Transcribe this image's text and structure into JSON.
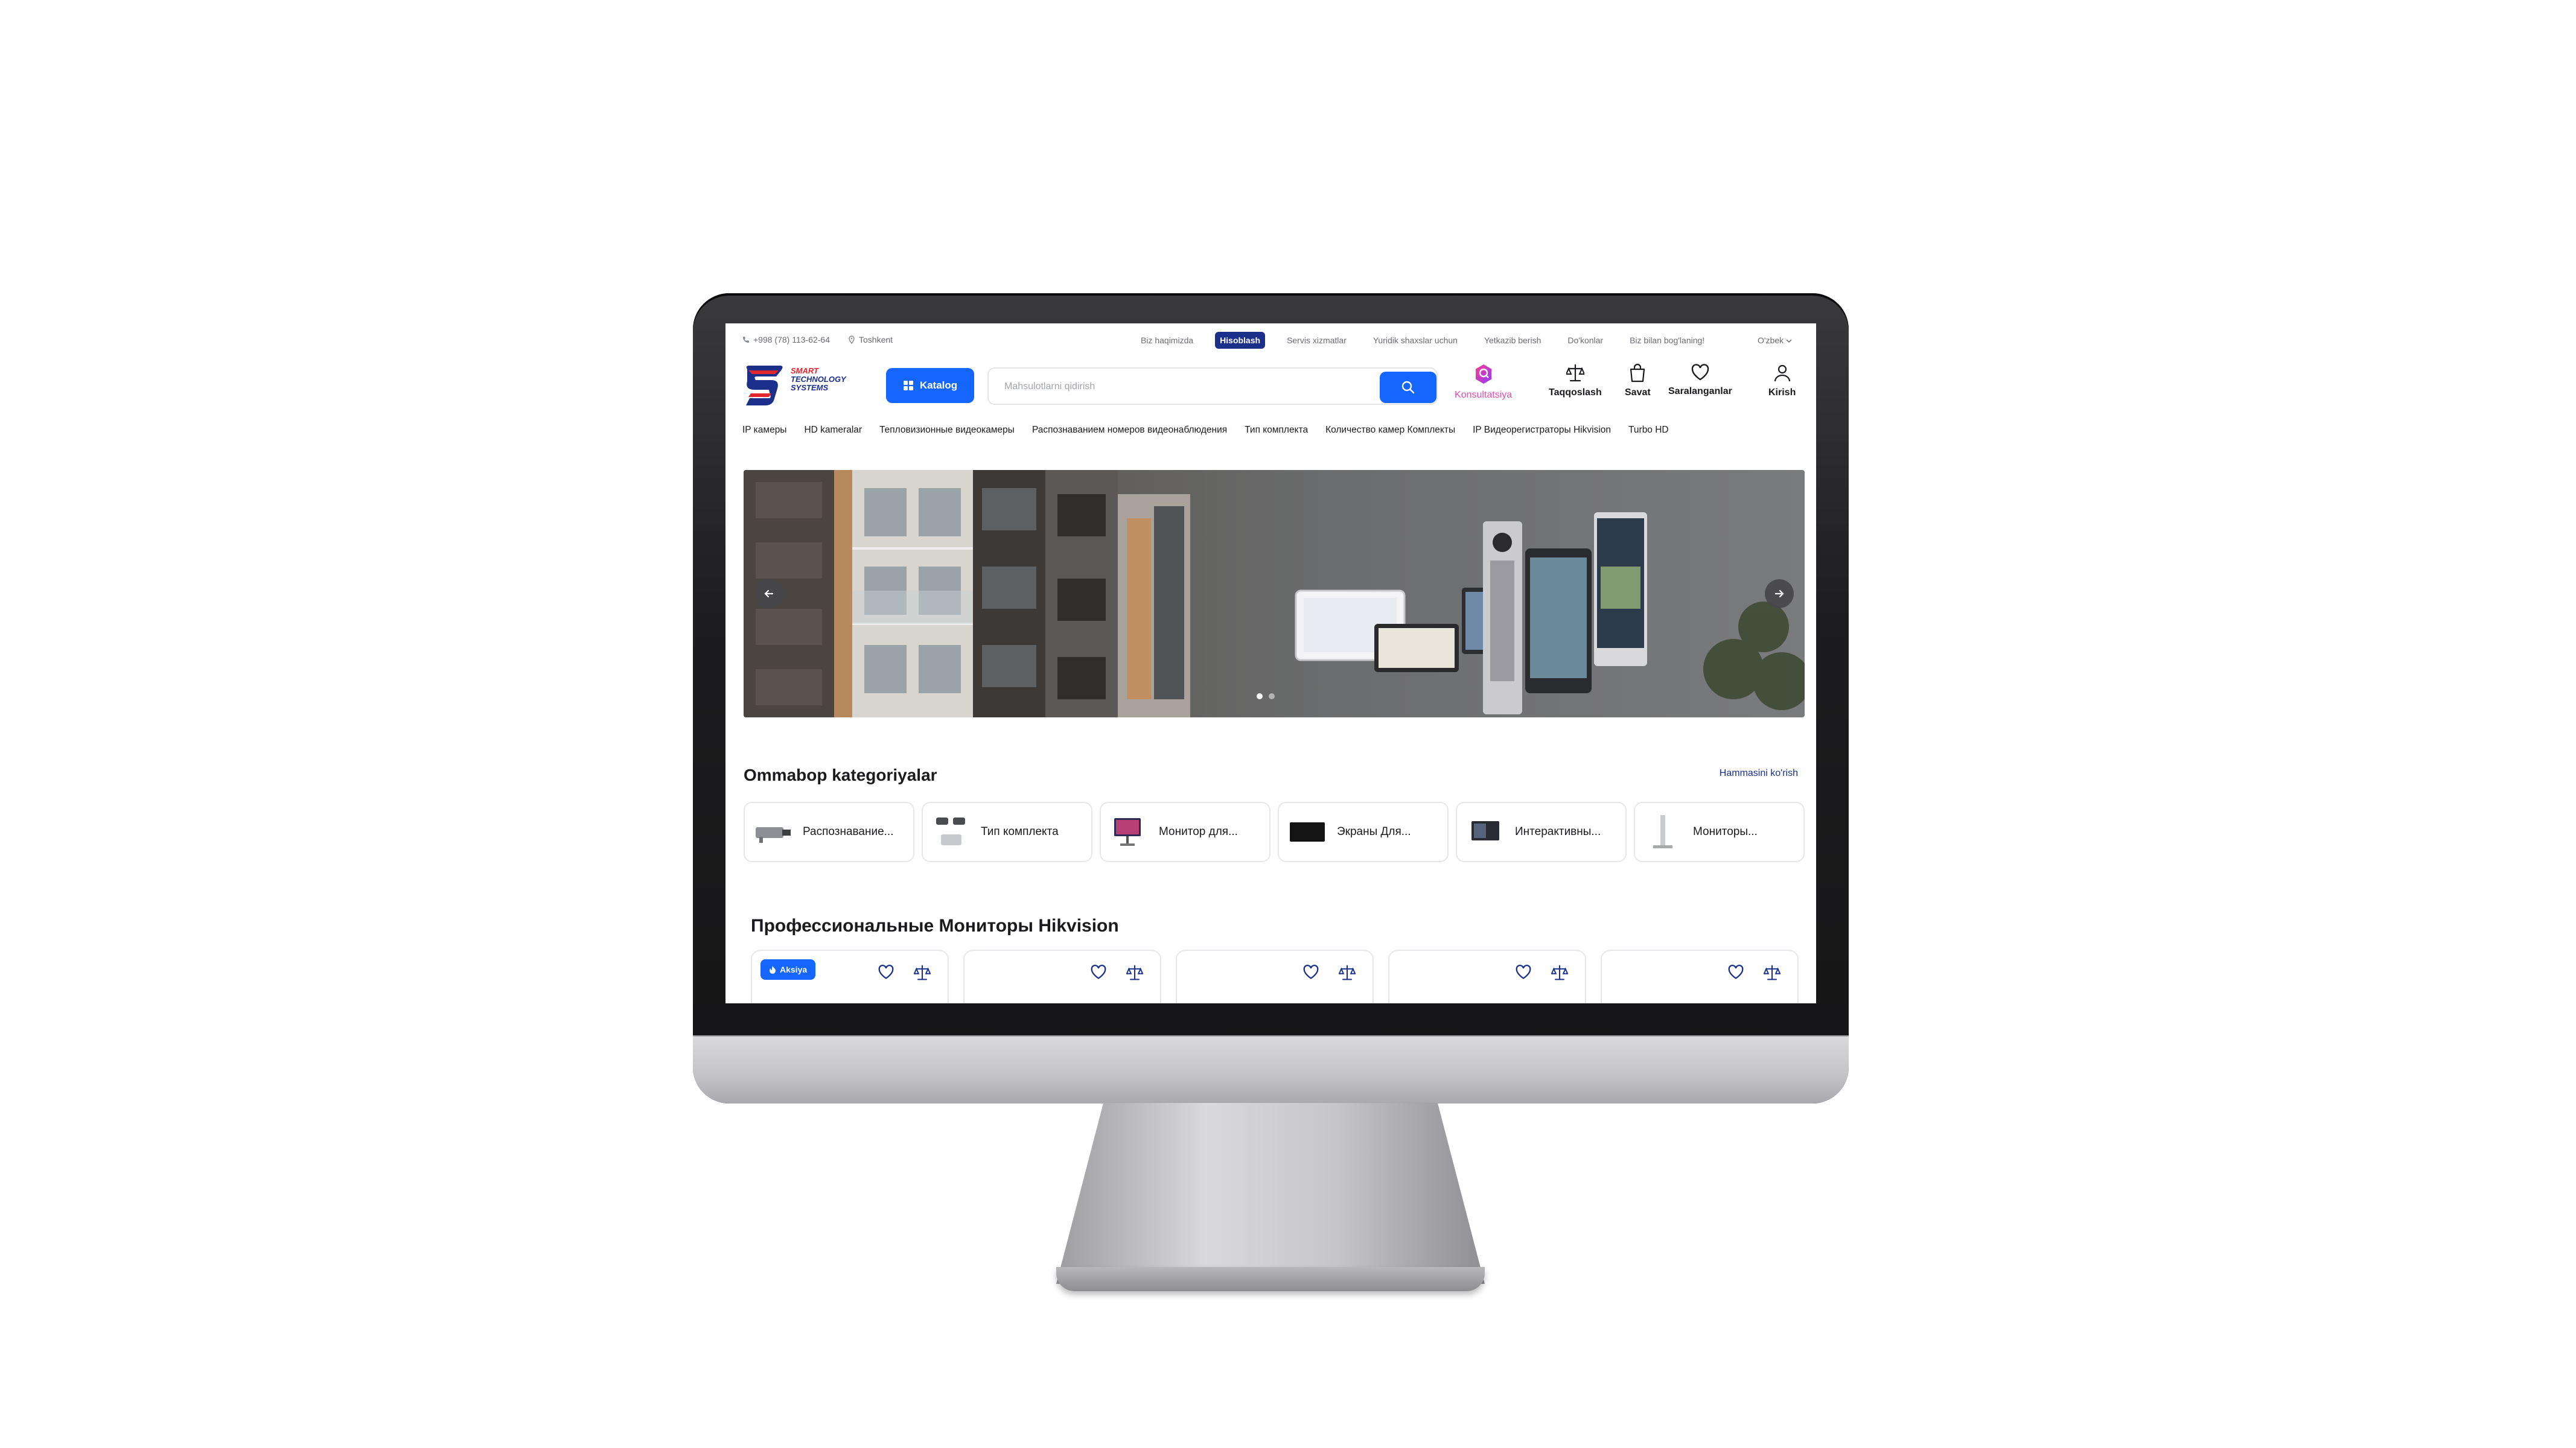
{
  "topbar": {
    "phone": "+998 (78) 113-62-64",
    "city": "Toshkent",
    "links": [
      "Biz haqimizda",
      "Hisoblash",
      "Servis xizmatlar",
      "Yuridik shaxslar uchun",
      "Yetkazib berish",
      "Do'konlar",
      "Biz bilan bog'laning!"
    ],
    "active_link": "Hisoblash",
    "language": "O'zbek"
  },
  "header": {
    "logo_lines": [
      "SMART",
      "TECHNOLOGY",
      "SYSTEMS"
    ],
    "catalog_label": "Katalog",
    "search_placeholder": "Mahsulotlarni qidirish",
    "actions": {
      "consult": "Konsultatsiya",
      "compare": "Taqqoslash",
      "cart": "Savat",
      "favorites": "Saralanganlar",
      "login": "Kirish"
    }
  },
  "catnav": [
    "IP камеры",
    "HD kameralar",
    "Тепловизионные видеокамеры",
    "Распознаванием номеров видеонаблюдения",
    "Тип комплекта",
    "Количество камер Комплекты",
    "IP Видеорегистраторы Hikvision",
    "Turbo HD"
  ],
  "banner": {
    "slide_count": 2,
    "active_slide": 0
  },
  "popular": {
    "title": "Ommabop kategoriyalar",
    "see_all": "Hammasini ko'rish",
    "items": [
      "Распознавание...",
      "Тип комплекта",
      "Монитор для...",
      "Экраны Для...",
      "Интерактивны...",
      "Мониторы..."
    ]
  },
  "products": {
    "title": "Профессиональные Мониторы Hikvision",
    "badge": "Aksiya",
    "card_count": 5
  },
  "colors": {
    "accent": "#1566ff",
    "brand": "#1c2f8a",
    "logo_red": "#e1262d"
  }
}
